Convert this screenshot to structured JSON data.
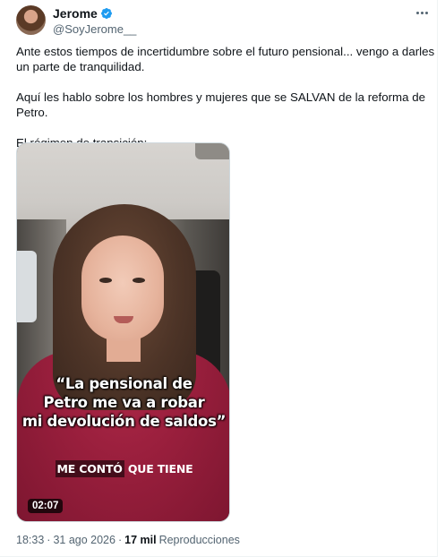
{
  "author": {
    "display_name": "Jerome",
    "handle": "@SoyJerome__",
    "verified": true
  },
  "tweet": {
    "paragraphs": [
      "Ante estos tiempos de incertidumbre sobre el futuro pensional... vengo a darles un parte de tranquilidad.",
      "Aquí les hablo sobre los hombres y mujeres que se SALVAN de la reforma de Petro.",
      "El régimen de transición:"
    ]
  },
  "media": {
    "caption_lines": [
      "“La pensional de",
      "Petro me va a robar",
      "mi devolución de saldos”"
    ],
    "subtitle_highlight": "ME CONTÓ",
    "subtitle_rest": " QUE TIENE",
    "duration": "02:07"
  },
  "meta": {
    "time": "18:33",
    "separator": "·",
    "date": "31 ago 2026",
    "views_count": "17 mil",
    "views_label": "Reproducciones"
  },
  "colors": {
    "text_primary": "#0f1419",
    "text_secondary": "#536471",
    "verified_blue": "#1d9bf0",
    "border": "#cfd9de"
  },
  "icons": [
    "verified-badge-icon",
    "more-options-icon"
  ]
}
